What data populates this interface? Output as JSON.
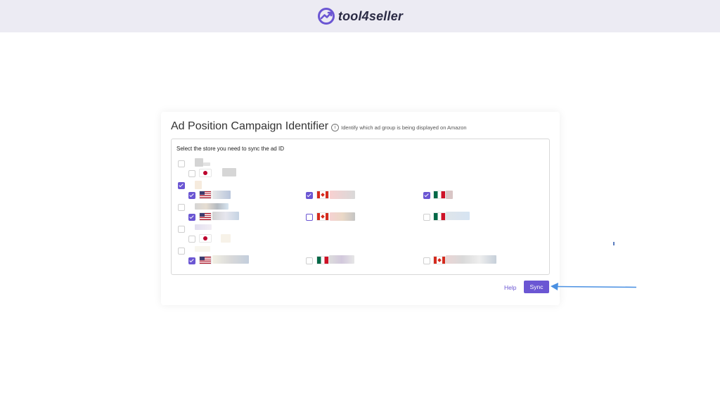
{
  "brand": {
    "name": "tool4seller",
    "accent": "#6b56d3"
  },
  "card": {
    "title": "Ad Position Campaign Identifier",
    "info_icon": "info-icon",
    "subtitle": "Identify which ad group is being displayed on Amazon",
    "select_label": "Select the store you need to sync the ad ID",
    "groups": [
      {
        "checked": false,
        "stores": [
          {
            "flag": "JP",
            "checked": false
          }
        ]
      },
      {
        "checked": true,
        "stores": [
          {
            "flag": "US",
            "checked": true
          },
          {
            "flag": "CA",
            "checked": true
          },
          {
            "flag": "MX",
            "checked": true
          }
        ]
      },
      {
        "checked": false,
        "stores": [
          {
            "flag": "US",
            "checked": true
          },
          {
            "flag": "CA",
            "checked": false
          },
          {
            "flag": "MX",
            "checked": false
          }
        ]
      },
      {
        "checked": false,
        "stores": [
          {
            "flag": "JP",
            "checked": false
          }
        ]
      },
      {
        "checked": false,
        "stores": [
          {
            "flag": "US",
            "checked": true
          },
          {
            "flag": "MX",
            "checked": false
          },
          {
            "flag": "CA",
            "checked": false
          }
        ]
      }
    ],
    "help_label": "Help",
    "sync_label": "Sync"
  }
}
